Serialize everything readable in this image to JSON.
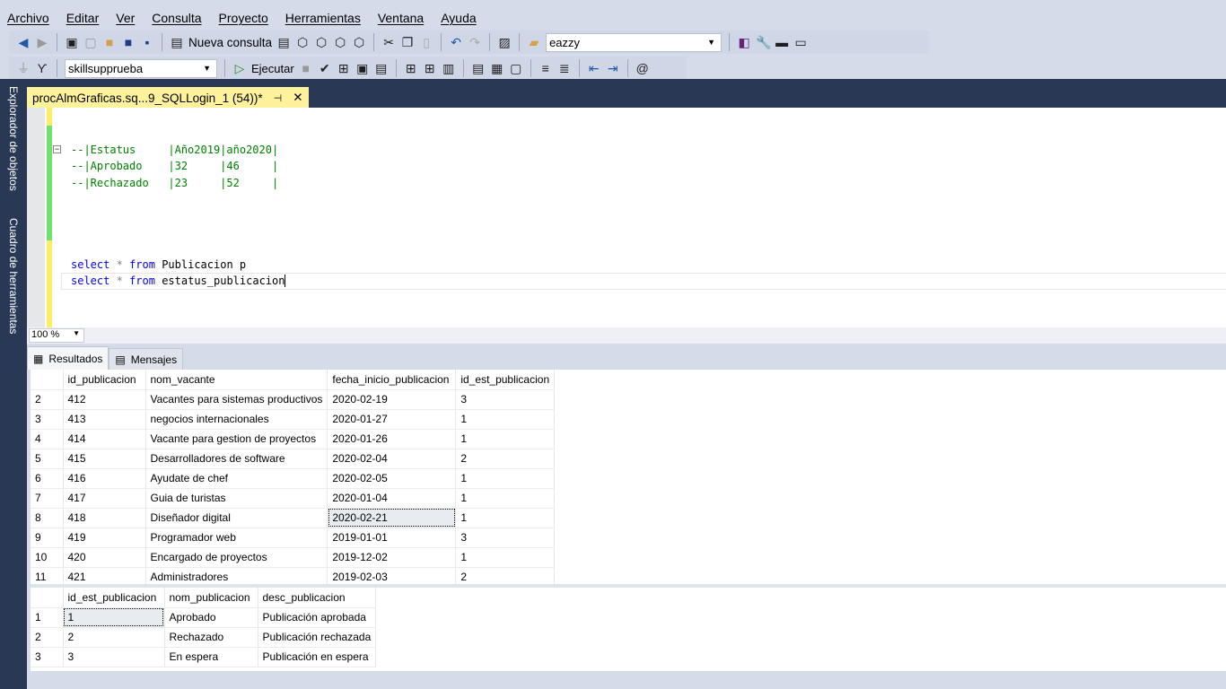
{
  "menu": [
    "Archivo",
    "Editar",
    "Ver",
    "Consulta",
    "Proyecto",
    "Herramientas",
    "Ventana",
    "Ayuda"
  ],
  "toolbar1": {
    "new_query": "Nueva consulta",
    "search_combo": "eazzy"
  },
  "toolbar2": {
    "database": "skillsupprueba",
    "execute": "Ejecutar"
  },
  "sidebar": {
    "object_explorer": "Explorador de objetos",
    "toolbox": "Cuadro de herramientas"
  },
  "doc_tab": {
    "title": "procAlmGraficas.sq...9_SQLLogin_1 (54))*"
  },
  "editor": {
    "comments": [
      "--|Estatus     |Año2019|año2020|",
      "--|Aprobado    |32     |46     |",
      "--|Rechazado   |23     |52     |"
    ],
    "queries": [
      {
        "kw1": "select",
        "star": "*",
        "kw2": "from",
        "rest": "Publicacion p"
      },
      {
        "kw1": "select",
        "star": "*",
        "kw2": "from",
        "rest": "estatus_publicacion"
      }
    ]
  },
  "zoom": "100 %",
  "result_tabs": [
    "Resultados",
    "Mensajes"
  ],
  "grid1": {
    "columns": [
      "id_publicacion",
      "nom_vacante",
      "fecha_inicio_publicacion",
      "id_est_publicacion"
    ],
    "rows": [
      [
        "2",
        "412",
        "Vacantes para sistemas productivos",
        "2020-02-19",
        "3"
      ],
      [
        "3",
        "413",
        "negocios internacionales",
        "2020-01-27",
        "1"
      ],
      [
        "4",
        "414",
        "Vacante para gestion de proyectos",
        "2020-01-26",
        "1"
      ],
      [
        "5",
        "415",
        "Desarrolladores de software",
        "2020-02-04",
        "2"
      ],
      [
        "6",
        "416",
        "Ayudate de chef",
        "2020-02-05",
        "1"
      ],
      [
        "7",
        "417",
        "Guia de turistas",
        "2020-01-04",
        "1"
      ],
      [
        "8",
        "418",
        "Diseñador digital",
        "2020-02-21",
        "1"
      ],
      [
        "9",
        "419",
        "Programador web",
        "2019-01-01",
        "3"
      ],
      [
        "10",
        "420",
        "Encargado de proyectos",
        "2019-12-02",
        "1"
      ],
      [
        "11",
        "421",
        "Administradores",
        "2019-02-03",
        "2"
      ]
    ]
  },
  "grid2": {
    "columns": [
      "id_est_publicacion",
      "nom_publicacion",
      "desc_publicacion"
    ],
    "rows": [
      [
        "1",
        "1",
        "Aprobado",
        "Publicación aprobada"
      ],
      [
        "2",
        "2",
        "Rechazado",
        "Publicación rechazada"
      ],
      [
        "3",
        "3",
        "En espera",
        "Publicación en espera"
      ]
    ]
  },
  "colors": {
    "dark": "#293955",
    "tab": "#fff29d",
    "keyword": "#0000ff",
    "comment": "#008000"
  }
}
